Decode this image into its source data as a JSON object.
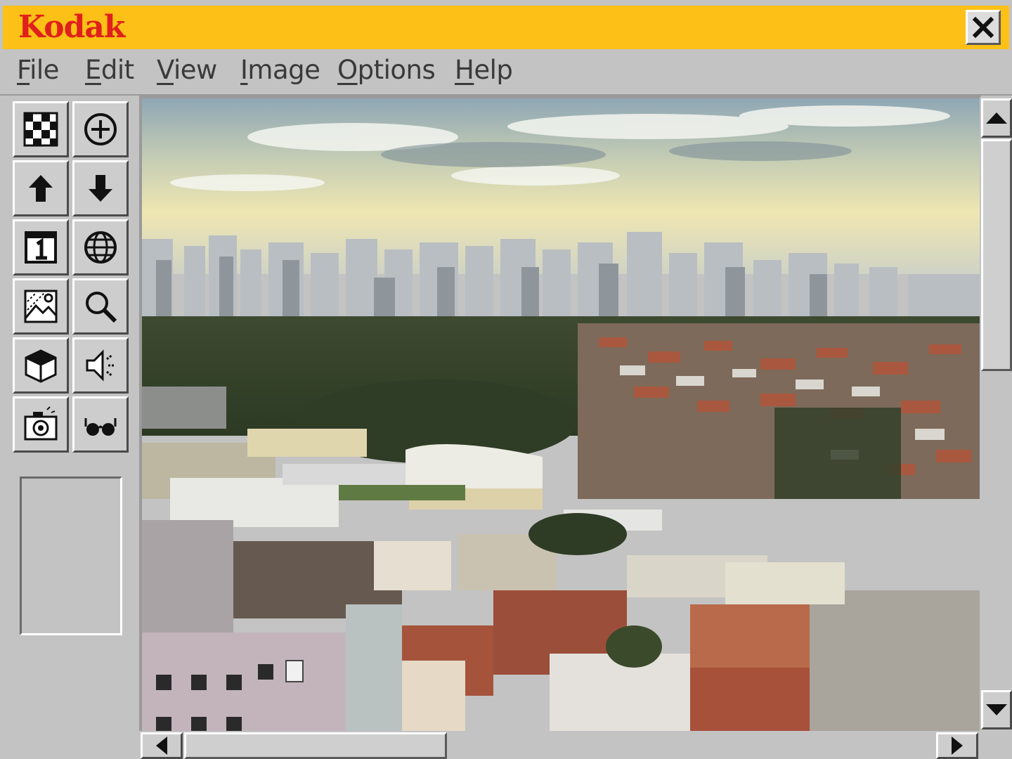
{
  "window": {
    "brand": "Kodak",
    "accent_color": "#fcc016",
    "brand_color": "#e0201c"
  },
  "menu": {
    "items": [
      {
        "label": "File"
      },
      {
        "label": "Edit"
      },
      {
        "label": "View"
      },
      {
        "label": "Image"
      },
      {
        "label": "Options"
      },
      {
        "label": "Help"
      }
    ]
  },
  "toolbar": {
    "tools": [
      {
        "icon": "checkerboard-icon"
      },
      {
        "icon": "zoom-in-icon"
      },
      {
        "icon": "arrow-up-icon"
      },
      {
        "icon": "arrow-down-icon"
      },
      {
        "icon": "calendar-one-icon"
      },
      {
        "icon": "globe-icon"
      },
      {
        "icon": "image-adjust-icon"
      },
      {
        "icon": "magnifier-icon"
      },
      {
        "icon": "box-3d-icon"
      },
      {
        "icon": "speaker-icon"
      },
      {
        "icon": "camera-icon"
      },
      {
        "icon": "glasses-icon"
      }
    ]
  },
  "viewer": {
    "image_subject": "city-skyline-photo"
  },
  "scrollbars": {
    "vertical_position": 0.0,
    "horizontal_position": 0.0
  }
}
